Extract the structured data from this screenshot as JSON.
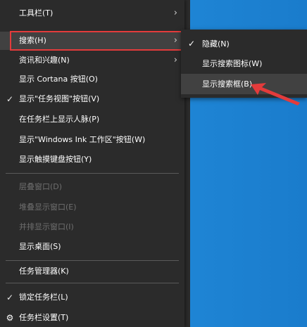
{
  "context_menu": {
    "items": [
      {
        "label": "工具栏(T)",
        "has_submenu": true
      },
      {
        "label": "搜索(H)",
        "has_submenu": true,
        "highlighted": true
      },
      {
        "label": "资讯和兴趣(N)",
        "has_submenu": true
      },
      {
        "label": "显示 Cortana 按钮(O)"
      },
      {
        "label": "显示\"任务视图\"按钮(V)",
        "checked": true
      },
      {
        "label": "在任务栏上显示人脉(P)"
      },
      {
        "label": "显示\"Windows Ink 工作区\"按钮(W)"
      },
      {
        "label": "显示触摸键盘按钮(Y)"
      },
      {
        "label": "层叠窗口(D)",
        "disabled": true
      },
      {
        "label": "堆叠显示窗口(E)",
        "disabled": true
      },
      {
        "label": "并排显示窗口(I)",
        "disabled": true
      },
      {
        "label": "显示桌面(S)"
      },
      {
        "label": "任务管理器(K)"
      },
      {
        "label": "锁定任务栏(L)",
        "checked": true
      },
      {
        "label": "任务栏设置(T)",
        "icon": "gear-icon"
      }
    ]
  },
  "search_submenu": {
    "items": [
      {
        "label": "隐藏(N)",
        "checked": true
      },
      {
        "label": "显示搜索图标(W)"
      },
      {
        "label": "显示搜索框(B)",
        "hovered": true
      }
    ]
  },
  "colors": {
    "menu_bg": "#2b2b2b",
    "hover_bg": "#414141",
    "annotation_red": "#e33b3b",
    "desktop_blue": "#1a77c4"
  }
}
